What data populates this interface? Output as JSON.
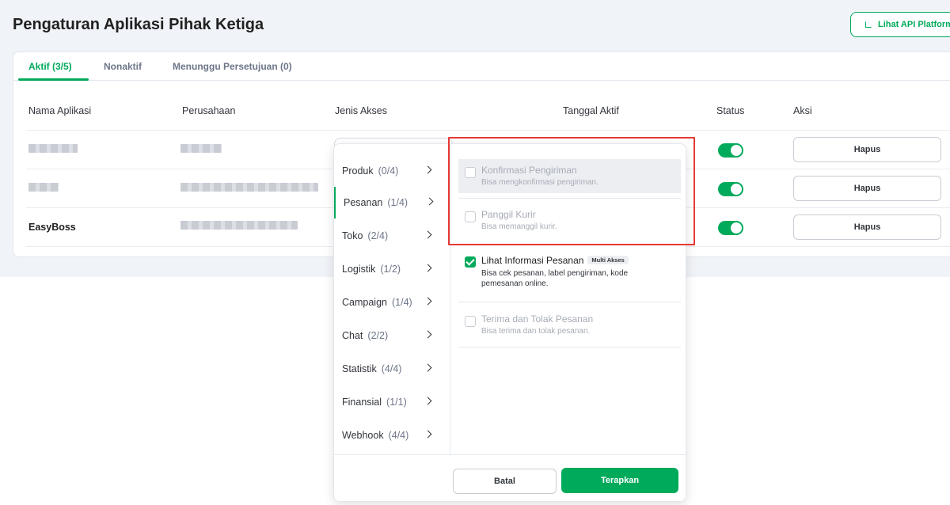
{
  "page": {
    "title": "Pengaturan Aplikasi Pihak Ketiga",
    "api_button_label": "Lihat API Platform"
  },
  "tabs": [
    {
      "label": "Aktif (3/5)",
      "active": true
    },
    {
      "label": "Nonaktif",
      "active": false
    },
    {
      "label": "Menunggu Persetujuan (0)",
      "active": false
    }
  ],
  "table": {
    "columns": [
      "Nama Aplikasi",
      "Perusahaan",
      "Jenis Akses",
      "Tanggal Aktif",
      "Status",
      "Aksi"
    ],
    "rows": [
      {
        "app_name": "",
        "status_on": true,
        "action": "Hapus"
      },
      {
        "app_name": "",
        "status_on": true,
        "action": "Hapus"
      },
      {
        "app_name": "EasyBoss",
        "status_on": true,
        "action": "Hapus"
      }
    ]
  },
  "dropdown": {
    "categories": [
      {
        "label": "Produk",
        "count": "(0/4)"
      },
      {
        "label": "Pesanan",
        "count": "(1/4)",
        "active": true
      },
      {
        "label": "Toko",
        "count": "(2/4)"
      },
      {
        "label": "Logistik",
        "count": "(1/2)"
      },
      {
        "label": "Campaign",
        "count": "(1/4)"
      },
      {
        "label": "Chat",
        "count": "(2/2)"
      },
      {
        "label": "Statistik",
        "count": "(4/4)"
      },
      {
        "label": "Finansial",
        "count": "(1/1)"
      },
      {
        "label": "Webhook",
        "count": "(4/4)"
      }
    ],
    "permissions": [
      {
        "title": "Konfirmasi Pengiriman",
        "desc": "Bisa mengkonfirmasi pengiriman.",
        "checked": false,
        "enabled": false
      },
      {
        "title": "Panggil Kurir",
        "desc": "Bisa memanggil kurir.",
        "checked": false,
        "enabled": false
      },
      {
        "title": "Lihat Informasi Pesanan",
        "badge": "Multi Akses",
        "desc": "Bisa cek pesanan, label pengiriman, kode pemesanan online.",
        "checked": true,
        "enabled": true
      },
      {
        "title": "Terima dan Tolak Pesanan",
        "desc": "Bisa terima dan tolak pesanan.",
        "checked": false,
        "enabled": false
      }
    ],
    "cancel_label": "Batal",
    "apply_label": "Terapkan"
  },
  "colors": {
    "accent": "#00aa5b",
    "highlight_border": "#e53935"
  }
}
